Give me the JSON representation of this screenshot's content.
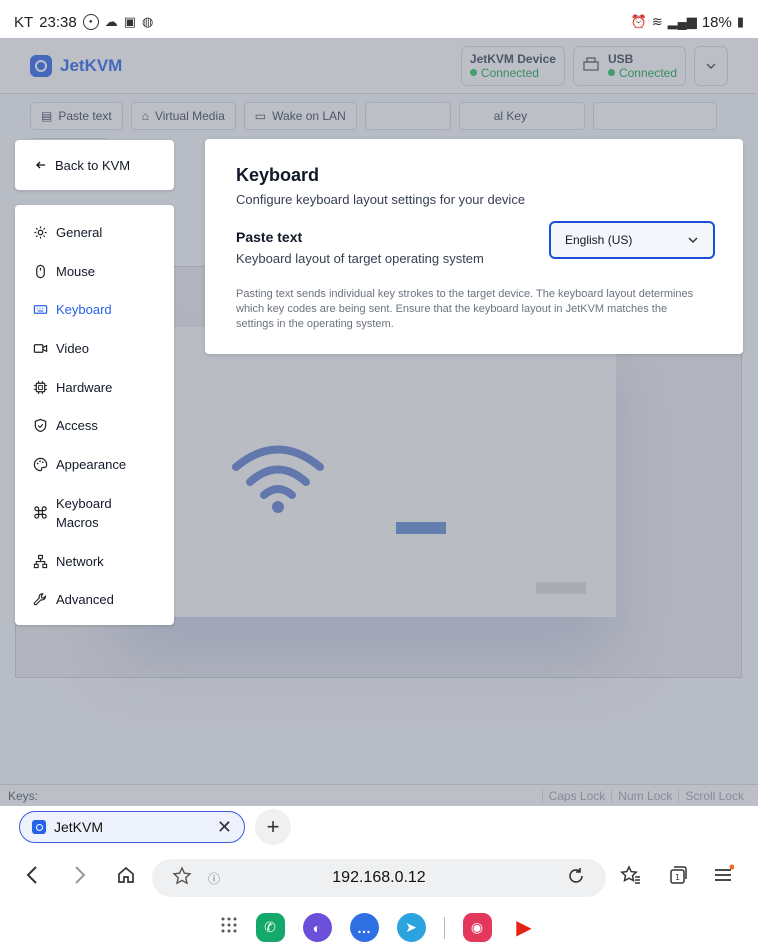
{
  "statusbar": {
    "carrier": "KT",
    "time": "23:38",
    "battery": "18%"
  },
  "app": {
    "brand": "JetKVM",
    "device_card": {
      "title": "JetKVM Device",
      "status": "Connected"
    },
    "usb_card": {
      "title": "USB",
      "status": "Connected"
    },
    "toolbar": [
      "Paste text",
      "Virtual Media",
      "Wake on LAN"
    ],
    "toolbar_row2_partial": "al Key",
    "keys_label": "Keys:",
    "locks": [
      "Caps Lock",
      "Num Lock",
      "Scroll Lock"
    ]
  },
  "settings": {
    "back_label": "Back to KVM",
    "nav": [
      {
        "label": "General",
        "icon": "gear-icon"
      },
      {
        "label": "Mouse",
        "icon": "mouse-icon"
      },
      {
        "label": "Keyboard",
        "icon": "keyboard-icon",
        "active": true
      },
      {
        "label": "Video",
        "icon": "video-icon"
      },
      {
        "label": "Hardware",
        "icon": "chip-icon"
      },
      {
        "label": "Access",
        "icon": "shield-icon"
      },
      {
        "label": "Appearance",
        "icon": "palette-icon"
      },
      {
        "label": "Keyboard Macros",
        "icon": "command-icon"
      },
      {
        "label": "Network",
        "icon": "network-icon"
      },
      {
        "label": "Advanced",
        "icon": "wrench-icon"
      }
    ],
    "panel": {
      "title": "Keyboard",
      "description": "Configure keyboard layout settings for your device",
      "setting_title": "Paste text",
      "setting_description": "Keyboard layout of target operating system",
      "selected_layout": "English (US)",
      "note": "Pasting text sends individual key strokes to the target device. The keyboard layout determines which key codes are being sent. Ensure that the keyboard layout in JetKVM matches the settings in the operating system."
    }
  },
  "browser": {
    "tab_title": "JetKVM",
    "url": "192.168.0.12"
  }
}
